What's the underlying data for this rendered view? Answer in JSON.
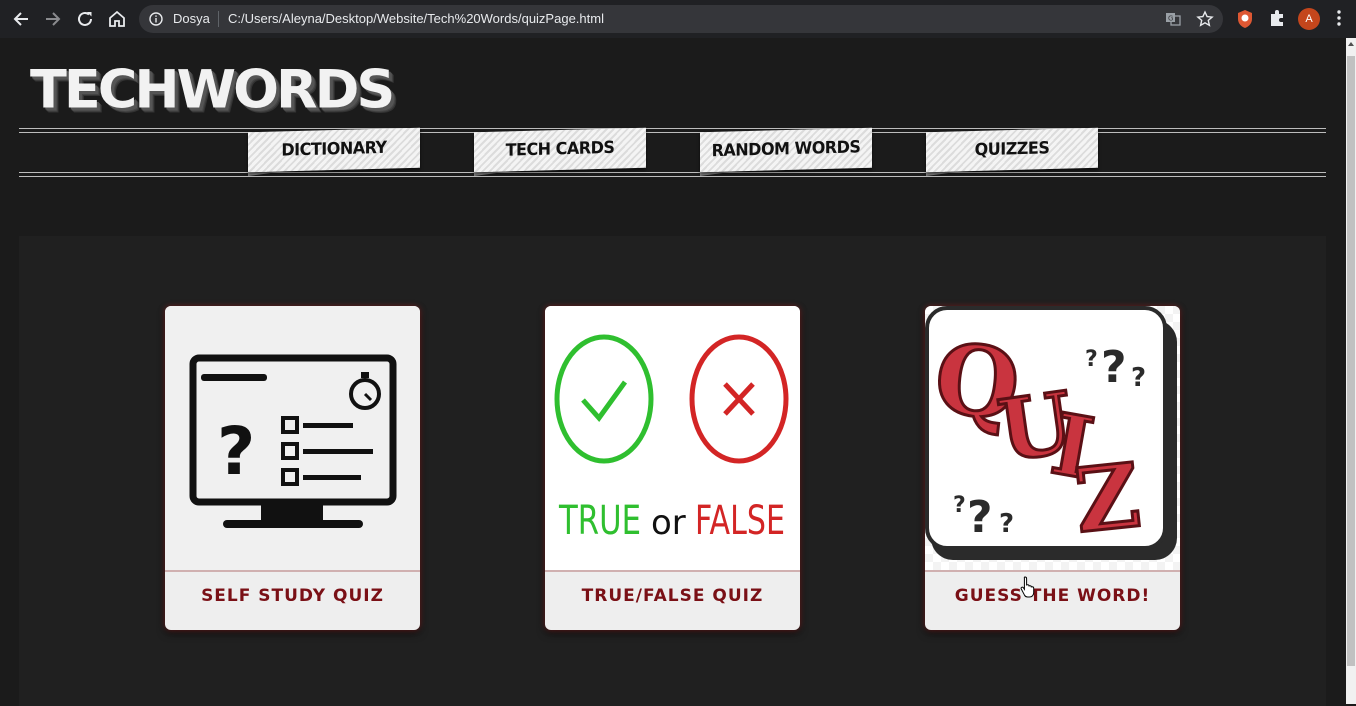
{
  "browser": {
    "site_name": "Dosya",
    "url": "C:/Users/Aleyna/Desktop/Website/Tech%20Words/quizPage.html",
    "profile_initial": "A"
  },
  "header": {
    "logo": "TECHWORDS"
  },
  "nav": {
    "tabs": [
      {
        "label": "DICTIONARY"
      },
      {
        "label": "TECH CARDS"
      },
      {
        "label": "RANDOM WORDS"
      },
      {
        "label": "QUIZZES"
      }
    ]
  },
  "quizzes": [
    {
      "title": "SELF STUDY QUIZ",
      "icon": "monitor-question-icon"
    },
    {
      "title": "TRUE/FALSE QUIZ",
      "icon": "true-false-icon",
      "image_text": {
        "true": "TRUE",
        "or": "or",
        "false": "FALSE"
      }
    },
    {
      "title": "GUESS THE WORD!",
      "icon": "quiz-letters-icon",
      "image_text": "QUIZ"
    }
  ],
  "colors": {
    "background": "#1b1b1b",
    "panel": "#202020",
    "caption": "#7a1016",
    "true_green": "#2fbf2f",
    "false_red": "#d32525"
  }
}
